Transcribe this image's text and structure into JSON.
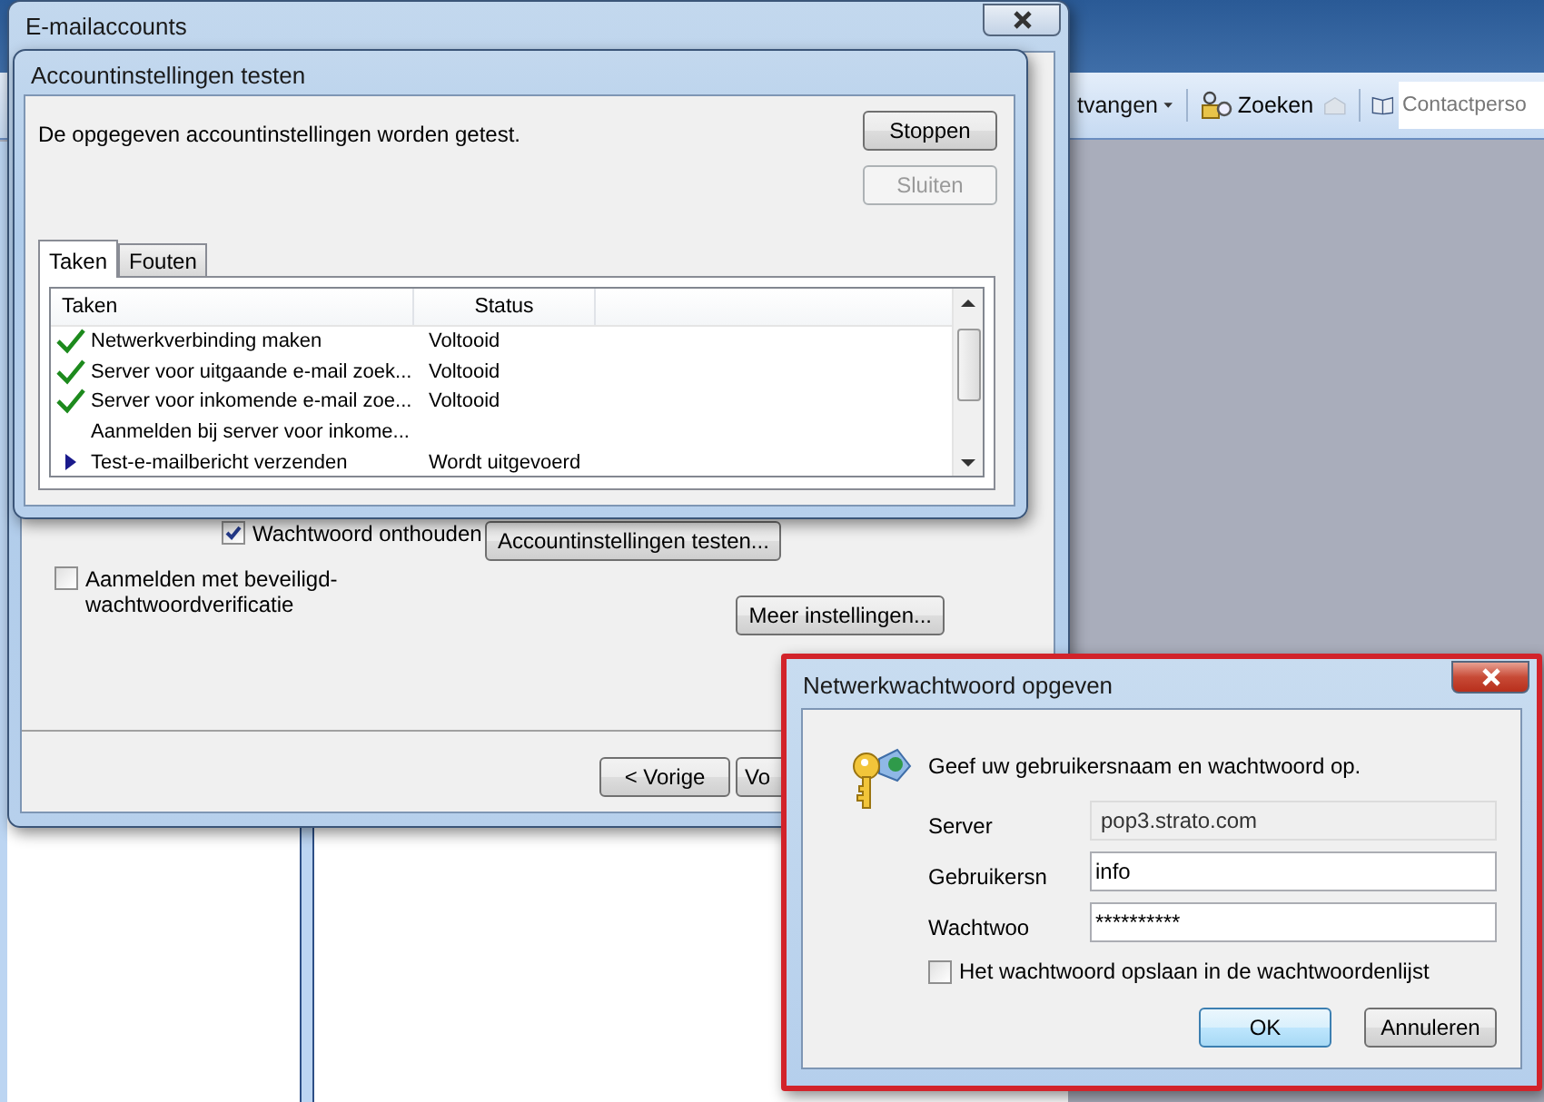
{
  "outlook_toolbar": {
    "send_receive": "tvangen",
    "search_button": "Zoeken",
    "contacts_search": {
      "placeholder": "Contactperso"
    }
  },
  "email_accounts_window": {
    "title": "E-mailaccounts",
    "remember_password": {
      "label": "Wachtwoord onthouden",
      "checked": true
    },
    "test_button": "Accountinstellingen testen...",
    "secure_logon": {
      "label": "Aanmelden met beveiligd-wachtwoordverificatie",
      "checked": false
    },
    "more_settings_button": "Meer instellingen...",
    "back_button": "< Vorige",
    "next_button": "Vo"
  },
  "test_dialog": {
    "title": "Accountinstellingen testen",
    "message": "De opgegeven accountinstellingen worden getest.",
    "buttons": [
      {
        "label": "Stoppen",
        "disabled": false
      },
      {
        "label": "Sluiten",
        "disabled": true
      }
    ],
    "tabs": [
      {
        "label": "Taken",
        "selected": true
      },
      {
        "label": "Fouten",
        "selected": false
      }
    ],
    "columns": [
      "Taken",
      "Status"
    ],
    "tasks": [
      {
        "kind": "done",
        "name": "Netwerkverbinding maken",
        "status": "Voltooid"
      },
      {
        "kind": "done",
        "name": "Server voor uitgaande e-mail zoek...",
        "status": "Voltooid"
      },
      {
        "kind": "done",
        "name": "Server voor inkomende e-mail zoe...",
        "status": "Voltooid"
      },
      {
        "kind": "pending",
        "name": "Aanmelden bij server voor inkome..."
      },
      {
        "kind": "running",
        "name": "Test-e-mailbericht verzenden",
        "status": "Wordt uitgevoerd"
      }
    ]
  },
  "password_dialog": {
    "title": "Netwerkwachtwoord opgeven",
    "prompt": "Geef uw gebruikersnaam en wachtwoord op.",
    "fields": [
      {
        "label": "Server",
        "value": "pop3.strato.com",
        "disabled": true
      },
      {
        "label": "Gebruikersn",
        "value": "info",
        "disabled": false
      },
      {
        "label": "Wachtwoo",
        "value": "**********",
        "disabled": false
      }
    ],
    "save_password": {
      "label": "Het wachtwoord opslaan in de wachtwoordenlijst",
      "checked": false
    },
    "buttons": [
      {
        "label": "OK",
        "default": true
      },
      {
        "label": "Annuleren",
        "default": false
      }
    ]
  }
}
